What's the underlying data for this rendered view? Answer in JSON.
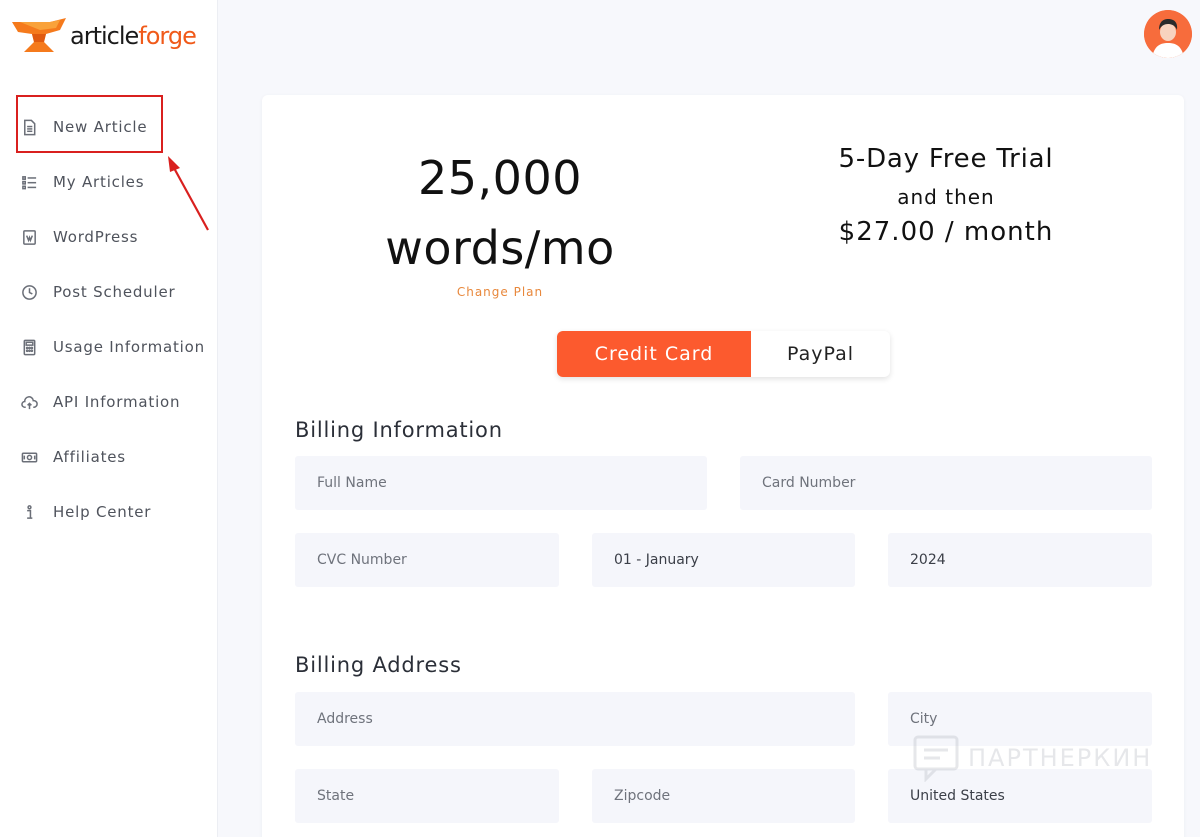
{
  "brand": {
    "name_part1": "article",
    "name_part2": "forge",
    "accent": "#fc5a2e"
  },
  "sidebar": {
    "items": [
      {
        "label": "New Article",
        "icon": "document-icon"
      },
      {
        "label": "My Articles",
        "icon": "list-icon"
      },
      {
        "label": "WordPress",
        "icon": "wordpress-icon"
      },
      {
        "label": "Post Scheduler",
        "icon": "clock-icon"
      },
      {
        "label": "Usage Information",
        "icon": "calculator-icon"
      },
      {
        "label": "API Information",
        "icon": "cloud-upload-icon"
      },
      {
        "label": "Affiliates",
        "icon": "money-icon"
      },
      {
        "label": "Help Center",
        "icon": "info-icon"
      }
    ]
  },
  "plan": {
    "words_line1": "25,000",
    "words_line2": "words/mo",
    "change_plan": "Change Plan",
    "trial_title": "5-Day Free Trial",
    "trial_sub": "and then",
    "trial_price": "$27.00 / month"
  },
  "payment_toggle": {
    "credit_card": "Credit Card",
    "paypal": "PayPal"
  },
  "billing_info": {
    "title": "Billing Information",
    "full_name_placeholder": "Full Name",
    "card_number_placeholder": "Card Number",
    "cvc_placeholder": "CVC Number",
    "month_value": "01 - January",
    "year_value": "2024"
  },
  "billing_address": {
    "title": "Billing Address",
    "address_placeholder": "Address",
    "city_placeholder": "City",
    "state_placeholder": "State",
    "zipcode_placeholder": "Zipcode",
    "country_value": "United States"
  },
  "watermark": {
    "text": "ПАРТНЕРКИН"
  }
}
